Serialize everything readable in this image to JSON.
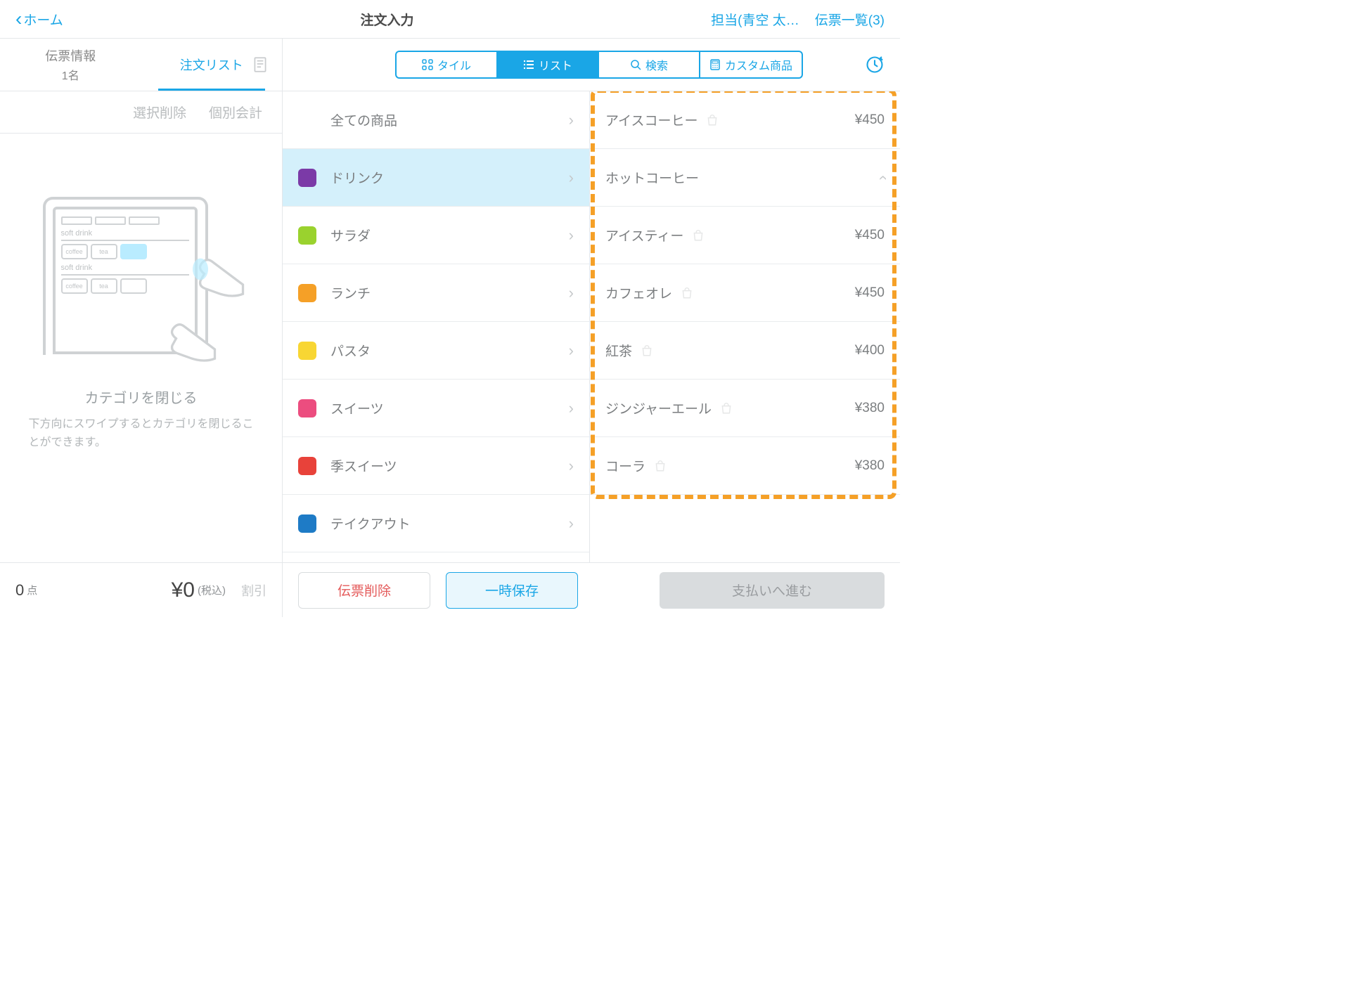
{
  "header": {
    "home": "ホーム",
    "title": "注文入力",
    "staff": "担当(青空 太…",
    "slips": "伝票一覧(3)"
  },
  "leftTabs": {
    "info": "伝票情報",
    "info_sub": "1名",
    "orders": "注文リスト"
  },
  "leftActions": {
    "delete_selected": "選択削除",
    "split_bill": "個別会計"
  },
  "illust": {
    "soft_drink": "soft drink",
    "coffee": "coffee",
    "tea": "tea",
    "title": "カテゴリを閉じる",
    "desc": "下方向にスワイプするとカテゴリを閉じることができます。"
  },
  "leftFooter": {
    "qty": "0",
    "qty_unit": "点",
    "total": "¥0",
    "tax": "(税込)",
    "discount": "割引"
  },
  "seg": {
    "tile": "タイル",
    "list": "リスト",
    "search": "検索",
    "custom": "カスタム商品"
  },
  "categories": [
    {
      "name": "全ての商品",
      "color": ""
    },
    {
      "name": "ドリンク",
      "color": "#7b3aa7"
    },
    {
      "name": "サラダ",
      "color": "#9ad22e"
    },
    {
      "name": "ランチ",
      "color": "#f5a027"
    },
    {
      "name": "パスタ",
      "color": "#f8d633"
    },
    {
      "name": "スイーツ",
      "color": "#ec4d7f"
    },
    {
      "name": "季スイーツ",
      "color": "#e8423a"
    },
    {
      "name": "テイクアウト",
      "color": "#1e7bc6"
    }
  ],
  "products": [
    {
      "name": "アイスコーヒー",
      "price": "¥450",
      "bag": true
    },
    {
      "name": "ホットコーヒー",
      "price": "",
      "bag": false,
      "expand": true
    },
    {
      "name": "アイスティー",
      "price": "¥450",
      "bag": true
    },
    {
      "name": "カフェオレ",
      "price": "¥450",
      "bag": true
    },
    {
      "name": "紅茶",
      "price": "¥400",
      "bag": true
    },
    {
      "name": "ジンジャーエール",
      "price": "¥380",
      "bag": true
    },
    {
      "name": "コーラ",
      "price": "¥380",
      "bag": true
    }
  ],
  "footerBtns": {
    "delete": "伝票削除",
    "save": "一時保存",
    "pay": "支払いへ進む"
  }
}
